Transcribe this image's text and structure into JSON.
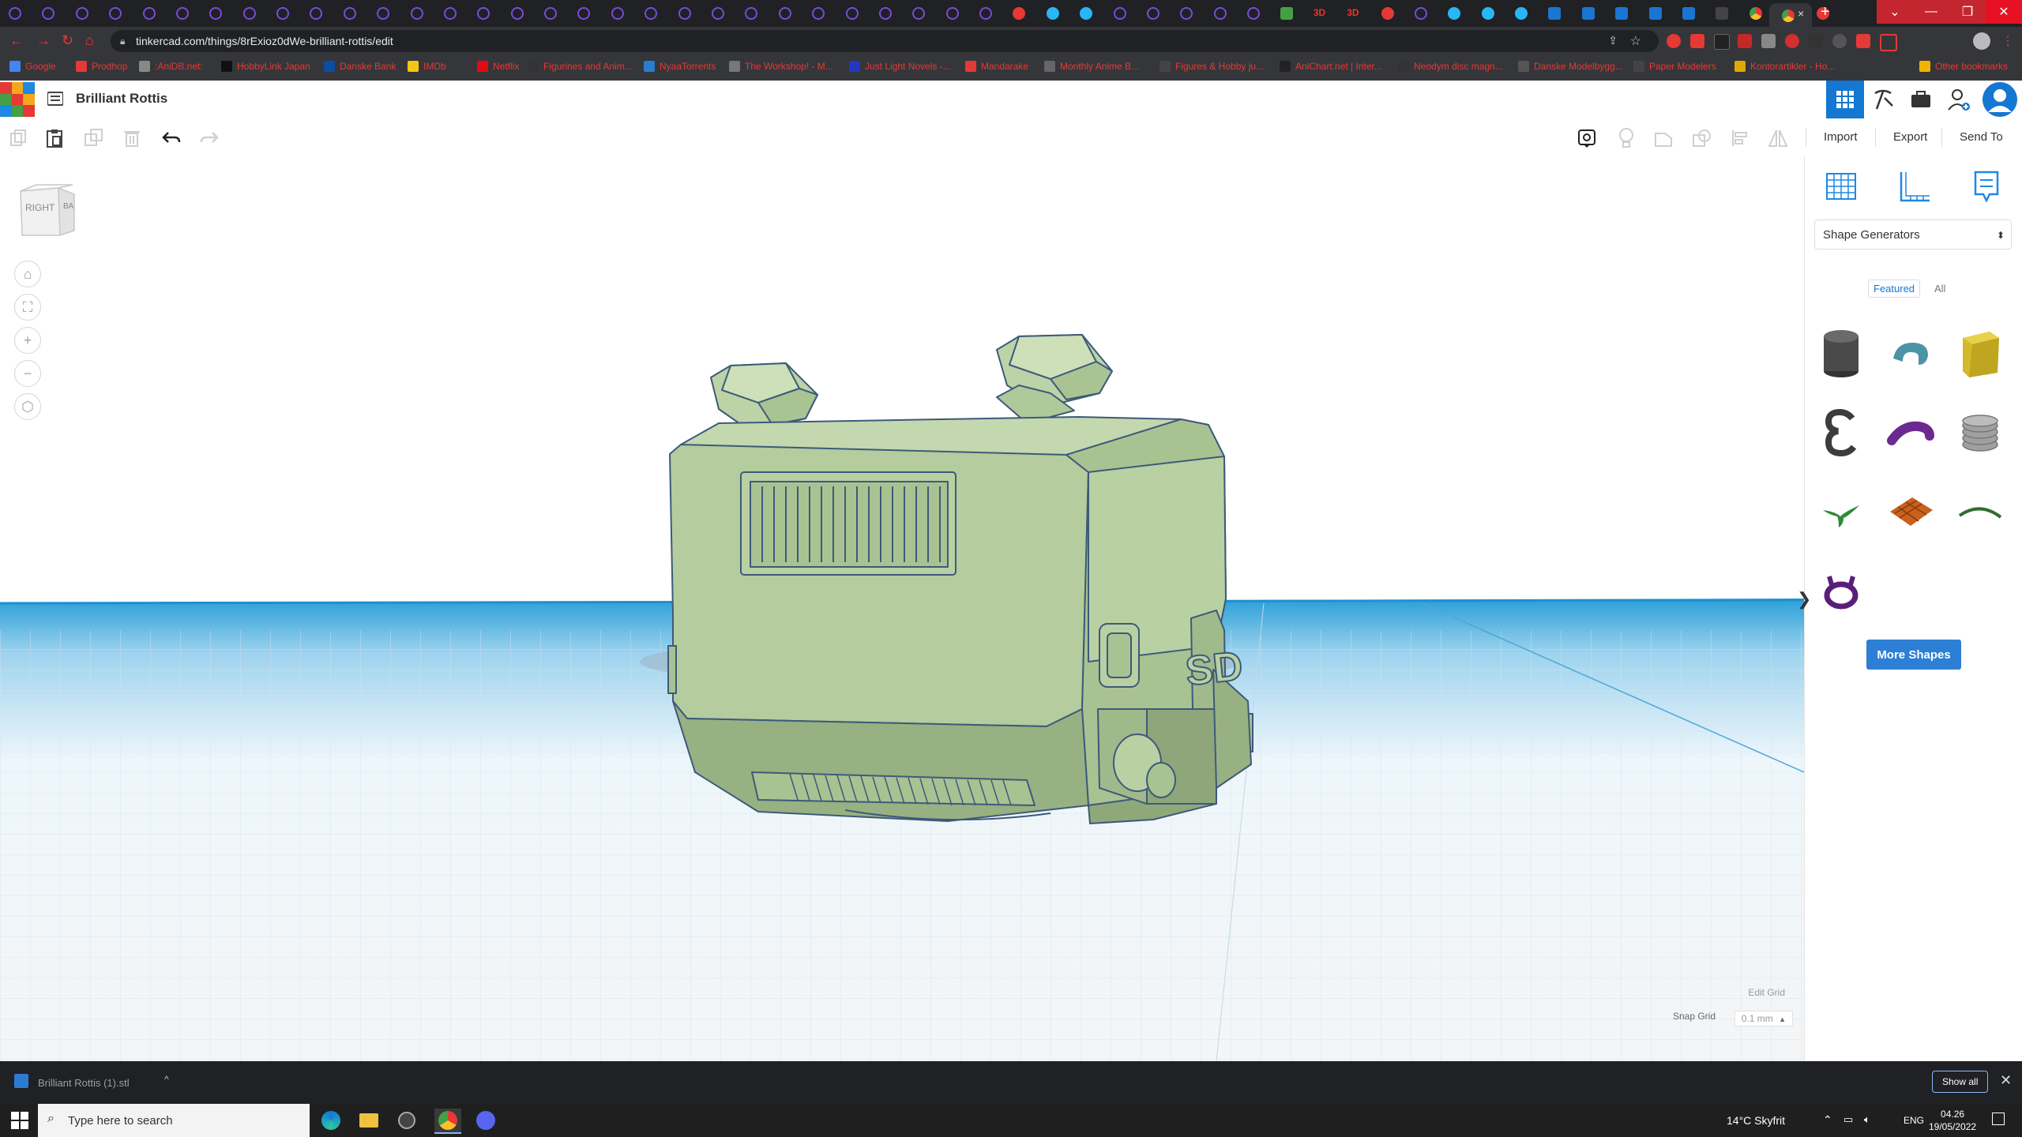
{
  "browser": {
    "url": "tinkercad.com/things/8rExioz0dWe-brilliant-rottis/edit",
    "tab_close": "×",
    "new_tab": "+"
  },
  "bookmarks": [
    {
      "label": "Google",
      "color": "#4285f4"
    },
    {
      "label": "Prodhop",
      "color": "#e53935"
    },
    {
      "label": ":AniDB.net:",
      "color": "#888888"
    },
    {
      "label": "HobbyLink Japan",
      "color": "#111111"
    },
    {
      "label": "Danske Bank",
      "color": "#0b4ea2"
    },
    {
      "label": "IMDb",
      "color": "#f5c518"
    },
    {
      "label": "Netflix",
      "color": "#e50914"
    },
    {
      "label": "Figurines and Anim...",
      "color": "#333333"
    },
    {
      "label": "NyaaTorrents",
      "color": "#2b7bd1"
    },
    {
      "label": "The Workshop! - M...",
      "color": "#777777"
    },
    {
      "label": "Just Light Novels -...",
      "color": "#2337c4"
    },
    {
      "label": "Mandarake",
      "color": "#e53935"
    },
    {
      "label": "Monthly Anime B...",
      "color": "#666666"
    },
    {
      "label": "Figures & Hobby ju...",
      "color": "#444444"
    },
    {
      "label": "AniChart.net | Inter...",
      "color": "#222222"
    },
    {
      "label": "Neodym disc magn...",
      "color": "#333333"
    },
    {
      "label": "Danske Modelbygg...",
      "color": "#555555"
    },
    {
      "label": "Paper Modelers",
      "color": "#444444"
    },
    {
      "label": "Kontorartikler - Ho...",
      "color": "#e0a800"
    },
    {
      "label": "Other bookmarks",
      "color": "#f0b400"
    }
  ],
  "app": {
    "logo_letters": [
      "TIN",
      "KER",
      "CAD"
    ],
    "design_title": "Brilliant Rottis",
    "header_buttons": [
      "3d-view",
      "build",
      "bricks",
      "add-user",
      "profile"
    ]
  },
  "toolbar": {
    "import_label": "Import",
    "export_label": "Export",
    "send_to_label": "Send To"
  },
  "workplane": {
    "viewcube_front": "RIGHT",
    "viewcube_side": "BA",
    "edit_grid_label": "Edit Grid",
    "snap_grid_label": "Snap Grid",
    "snap_grid_value": "0.1 mm",
    "snap_grid_arrow": "▲",
    "nav_controls": [
      "home-view",
      "fit-all",
      "zoom-in",
      "zoom-out",
      "perspective"
    ],
    "model_color": "#b5cda0"
  },
  "panel": {
    "collapse_glyph": "❯",
    "shape_category": "Shape Generators",
    "select_arrows": "⬍",
    "tab_featured": "Featured",
    "tab_all": "All",
    "more_shapes_label": "More Shapes",
    "shapes": [
      {
        "name": "cylinder",
        "color": "#4a4a4a"
      },
      {
        "name": "torus-hook",
        "color": "#4a94a6"
      },
      {
        "name": "gold-box",
        "color": "#d4b92a"
      },
      {
        "name": "letter-e",
        "color": "#3c3c3c"
      },
      {
        "name": "purple-tube",
        "color": "#6a2a90"
      },
      {
        "name": "grey-spring",
        "color": "#999999"
      },
      {
        "name": "green-star",
        "color": "#2e8a3a"
      },
      {
        "name": "orange-lattice",
        "color": "#c8611e"
      },
      {
        "name": "green-arc",
        "color": "#2e6e2e"
      },
      {
        "name": "purple-hoops",
        "color": "#5a1e7a"
      }
    ]
  },
  "downloads": {
    "file_name": "Brilliant Rottis (1).stl",
    "chevron": "^",
    "show_all_label": "Show all",
    "close_glyph": "✕"
  },
  "taskbar": {
    "search_placeholder": "Type here to search",
    "weather": "14°C  Skyfrit",
    "lang": "ENG",
    "time": "04.26",
    "date": "19/05/2022"
  }
}
